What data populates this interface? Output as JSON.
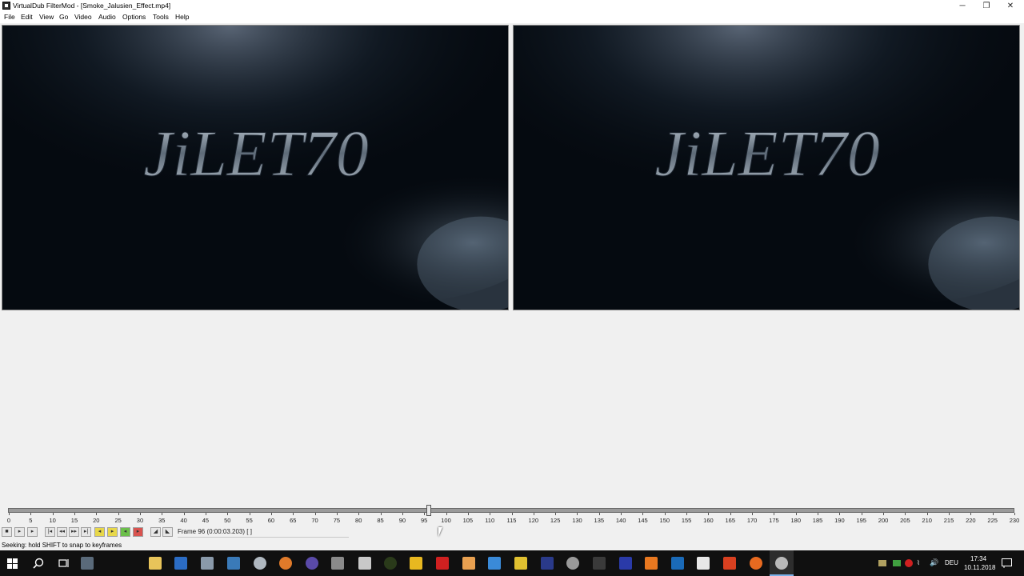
{
  "window": {
    "title": "VirtualDub FilterMod  - [Smoke_Jalusien_Effect.mp4]",
    "minimize": "─",
    "maximize": "❐",
    "close": "✕"
  },
  "menu": [
    "File",
    "Edit",
    "View",
    "Go",
    "Video",
    "Audio",
    "Options",
    "Tools",
    "Help"
  ],
  "video": {
    "input_text": "JiLET70",
    "output_text": "JiLET70"
  },
  "timeline": {
    "min": 0,
    "max": 230,
    "tick_labels": [
      "0",
      "5",
      "10",
      "15",
      "20",
      "25",
      "30",
      "35",
      "40",
      "45",
      "50",
      "55",
      "60",
      "65",
      "70",
      "75",
      "80",
      "85",
      "90",
      "95",
      "100",
      "105",
      "110",
      "115",
      "120",
      "125",
      "130",
      "135",
      "140",
      "145",
      "150",
      "155",
      "160",
      "165",
      "170",
      "175",
      "180",
      "185",
      "190",
      "195",
      "200",
      "205",
      "210",
      "215",
      "220",
      "225",
      "230"
    ],
    "current_frame": 96
  },
  "frame_display": "Frame 96 (0:00:03.203) [ ]",
  "status": "Seeking: hold SHIFT to snap to keyframes",
  "tray": {
    "language": "DEU",
    "time": "17:34",
    "date": "10.11.2018"
  },
  "colors": {
    "taskbar_bg": "#101010",
    "titlebar_bg": "#ffffff",
    "window_bg": "#f0f0f0",
    "video_bg": "#050a10",
    "timeline_bar": "#9a9a9a"
  }
}
